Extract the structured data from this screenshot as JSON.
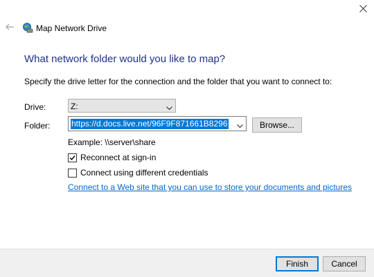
{
  "window": {
    "title": "Map Network Drive",
    "close_glyph": "✕",
    "back_glyph": "←",
    "icon": "network-drive-icon"
  },
  "main": {
    "heading": "What network folder would you like to map?",
    "instruction": "Specify the drive letter for the connection and the folder that you want to connect to:",
    "drive_label": "Drive:",
    "drive_value": "Z:",
    "folder_label": "Folder:",
    "folder_value": "https://d.docs.live.net/96F9F871661B8296",
    "browse_label": "Browse...",
    "example_text": "Example: \\\\server\\share",
    "reconnect_label": "Reconnect at sign-in",
    "reconnect_checked": true,
    "credentials_label": "Connect using different credentials",
    "credentials_checked": false,
    "link_text": "Connect to a Web site that you can use to store your documents and pictures"
  },
  "footer": {
    "finish_label": "Finish",
    "cancel_label": "Cancel"
  },
  "colors": {
    "heading": "#1e3287",
    "link": "#0066cc",
    "selection": "#0078d7",
    "footer_bg": "#f0f0f0"
  }
}
